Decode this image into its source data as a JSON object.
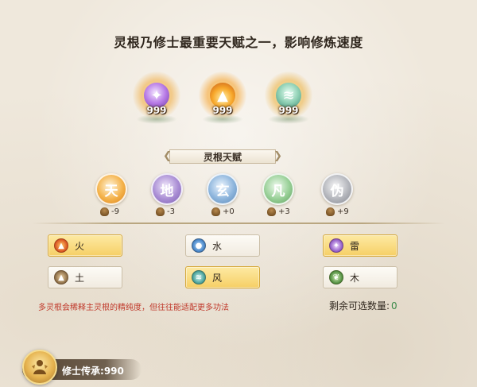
{
  "headline": "灵根乃修士最重要天赋之一，影响修炼速度",
  "orbs": [
    {
      "icon": "purple-lightning-orb-icon",
      "count": "999",
      "color": "#a86ad6"
    },
    {
      "icon": "flame-orb-icon",
      "count": "999",
      "color": "#f08a1c"
    },
    {
      "icon": "whirlwind-orb-icon",
      "count": "999",
      "color": "#7ab8a0"
    }
  ],
  "section_title": "灵根天赋",
  "talents": [
    {
      "glyph": "天",
      "modifier": "-9",
      "color": "#f0a33c"
    },
    {
      "glyph": "地",
      "modifier": "-3",
      "color": "#a58bd1"
    },
    {
      "glyph": "玄",
      "modifier": "+0",
      "color": "#7fa6cf"
    },
    {
      "glyph": "凡",
      "modifier": "+3",
      "color": "#86c18a"
    },
    {
      "glyph": "伪",
      "modifier": "+9",
      "color": "#a8aab0"
    }
  ],
  "elements": [
    {
      "label": "火",
      "icon": "fire-icon",
      "selected": true,
      "color": "#d9501f"
    },
    {
      "label": "水",
      "icon": "water-drop-icon",
      "selected": false,
      "color": "#3f7fc4"
    },
    {
      "label": "雷",
      "icon": "lightning-icon",
      "selected": true,
      "color": "#8d55c4"
    },
    {
      "label": "土",
      "icon": "earth-icon",
      "selected": false,
      "color": "#8a6b44"
    },
    {
      "label": "风",
      "icon": "wind-icon",
      "selected": true,
      "color": "#3f9b94"
    },
    {
      "label": "木",
      "icon": "leaf-icon",
      "selected": false,
      "color": "#4b8a3a"
    }
  ],
  "hint": "多灵根会稀释主灵根的精纯度，但往往能适配更多功法",
  "remaining": {
    "label": "剩余可选数量:",
    "value": "0"
  },
  "legacy": {
    "label": "修士传承:",
    "value": "990"
  }
}
